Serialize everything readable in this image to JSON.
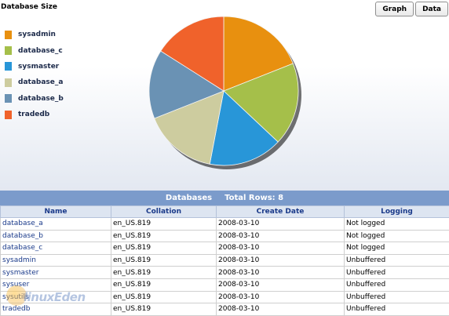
{
  "chart_title": "Database Size",
  "buttons": {
    "graph": "Graph",
    "data": "Data"
  },
  "chart_data": {
    "type": "pie",
    "title": "Database Size",
    "labels": [
      "sysadmin",
      "database_c",
      "sysmaster",
      "database_a",
      "database_b",
      "tradedb"
    ],
    "values": [
      19,
      18,
      16,
      16,
      15,
      16
    ],
    "colors": [
      "#e8900f",
      "#a5bf4a",
      "#2896d8",
      "#cdcc9f",
      "#6a92b4",
      "#f0622b"
    ],
    "legend_position": "left"
  },
  "table": {
    "caption": "Databases",
    "total_rows_label": "Total Rows: 8",
    "columns": [
      "Name",
      "Collation",
      "Create Date",
      "Logging"
    ],
    "rows": [
      [
        "database_a",
        "en_US.819",
        "2008-03-10",
        "Not logged"
      ],
      [
        "database_b",
        "en_US.819",
        "2008-03-10",
        "Not logged"
      ],
      [
        "database_c",
        "en_US.819",
        "2008-03-10",
        "Not logged"
      ],
      [
        "sysadmin",
        "en_US.819",
        "2008-03-10",
        "Unbuffered"
      ],
      [
        "sysmaster",
        "en_US.819",
        "2008-03-10",
        "Unbuffered"
      ],
      [
        "sysuser",
        "en_US.819",
        "2008-03-10",
        "Unbuffered"
      ],
      [
        "sysutils",
        "en_US.819",
        "2008-03-10",
        "Unbuffered"
      ],
      [
        "tradedb",
        "en_US.819",
        "2008-03-10",
        "Unbuffered"
      ]
    ]
  },
  "watermark": "linuxEden"
}
